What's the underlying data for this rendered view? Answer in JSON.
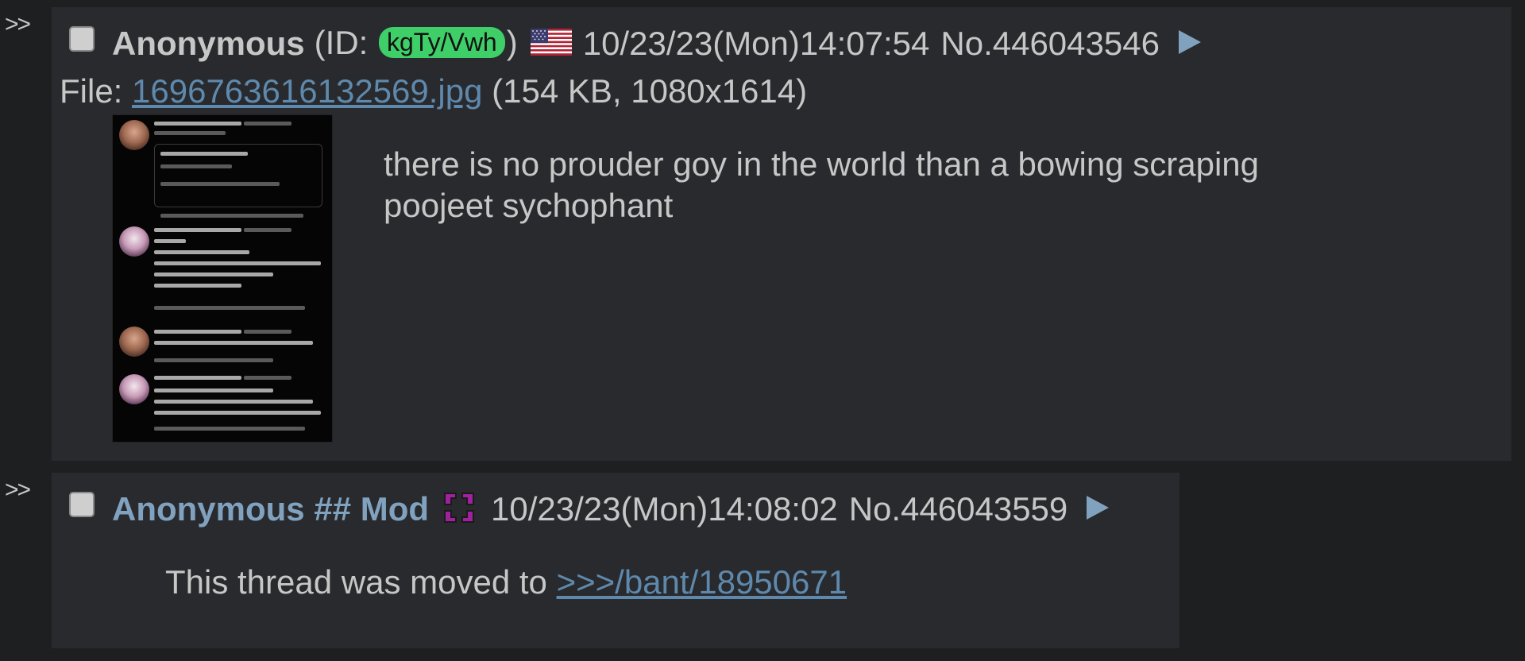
{
  "posts": [
    {
      "arrows": ">>",
      "name": "Anonymous",
      "id_prefix": "(ID: ",
      "id_value": "kgTy/Vwh",
      "id_suffix": ")",
      "flag_icon": "us-flag-icon",
      "datetime": "10/23/23(Mon)14:07:54",
      "postnum": "No.446043546",
      "file": {
        "prefix": "File: ",
        "filename": "1696763616132569.jpg",
        "meta": " (154 KB, 1080x1614)"
      },
      "message_lines": [
        "there is no prouder goy in the world than a bowing scraping",
        "poojeet sychophant"
      ]
    },
    {
      "arrows": ">>",
      "name": "Anonymous ## Mod",
      "capcode_icon": "mod-capcode-icon",
      "datetime": "10/23/23(Mon)14:08:02",
      "postnum": "No.446043559",
      "message_prefix": "This thread was moved to ",
      "message_link": ">>>/bant/18950671"
    }
  ],
  "colors": {
    "background": "#1d1f21",
    "post_background": "#282a2e",
    "text": "#c5c8c6",
    "link": "#5f89ac",
    "mod_name": "#81a2be",
    "id_badge": "#3fcf68",
    "mod_icon": "#a020a0"
  }
}
